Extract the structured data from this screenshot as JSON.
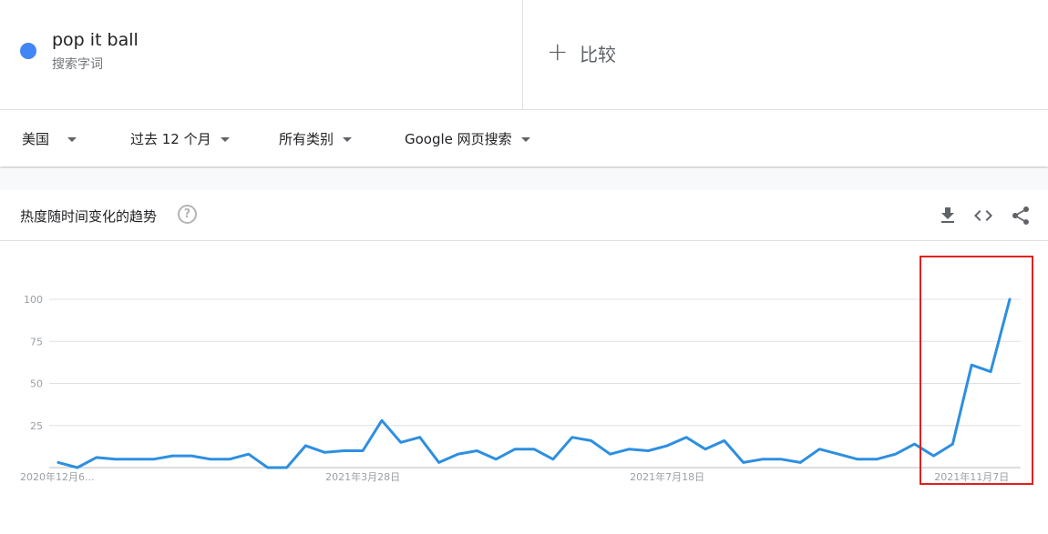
{
  "search_term": {
    "name": "pop it ball",
    "subtitle": "搜索字词",
    "color": "#4285f4"
  },
  "compare": {
    "label": "比较"
  },
  "filters": {
    "region": "美国",
    "period": "过去 12 个月",
    "category": "所有类别",
    "search_type": "Google 网页搜索"
  },
  "card": {
    "title": "热度随时间变化的趋势"
  },
  "icons": [
    "help-icon",
    "download-icon",
    "embed-icon",
    "share-icon"
  ],
  "chart_data": {
    "type": "line",
    "x": [
      "2020年12月6...",
      "",
      "",
      "",
      "",
      "",
      "",
      "",
      "",
      "",
      "",
      "",
      "",
      "",
      "",
      "",
      "2021年3月28日",
      "",
      "",
      "",
      "",
      "",
      "",
      "",
      "",
      "",
      "",
      "",
      "",
      "",
      "",
      "",
      "2021年7月18日",
      "",
      "",
      "",
      "",
      "",
      "",
      "",
      "",
      "",
      "",
      "",
      "",
      "",
      "",
      "",
      "2021年11月7日",
      "",
      ""
    ],
    "x_tick_labels": [
      "2020年12月6...",
      "2021年3月28日",
      "2021年7月18日",
      "2021年11月7日"
    ],
    "series": [
      {
        "color": "#2d8fe0",
        "values": [
          3,
          0,
          6,
          5,
          5,
          5,
          7,
          7,
          5,
          5,
          8,
          0,
          0,
          13,
          9,
          10,
          10,
          28,
          15,
          18,
          3,
          8,
          10,
          5,
          11,
          11,
          5,
          18,
          16,
          8,
          11,
          10,
          13,
          18,
          11,
          16,
          3,
          5,
          5,
          3,
          11,
          8,
          5,
          5,
          8,
          14,
          7,
          14,
          61,
          57,
          100
        ]
      }
    ],
    "yticks": [
      25,
      50,
      75,
      100
    ],
    "ylim": [
      0,
      100
    ],
    "grid": true,
    "annotation": "red rectangle highlighting the final weeks surge"
  }
}
